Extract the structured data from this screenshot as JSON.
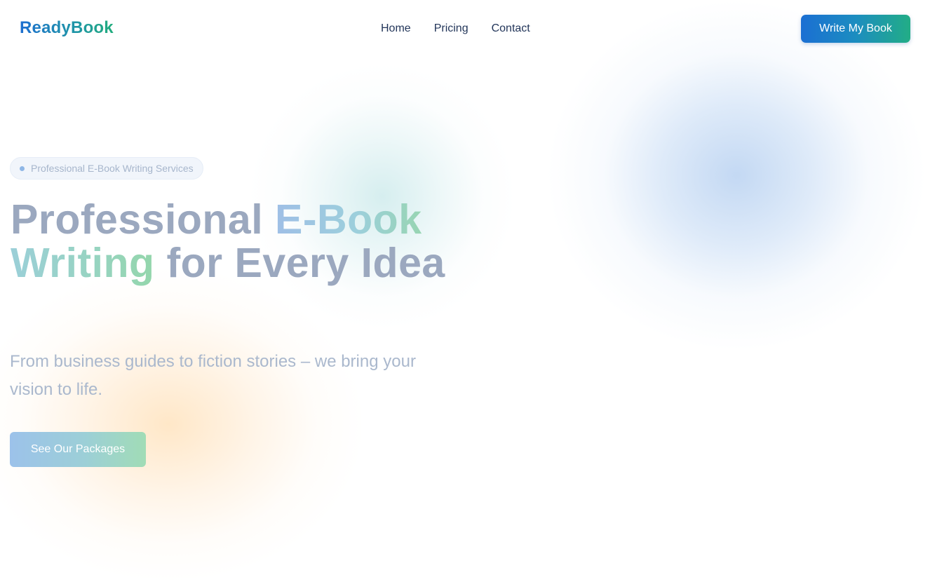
{
  "header": {
    "logo": "ReadyBook",
    "nav": [
      {
        "label": "Home"
      },
      {
        "label": "Pricing"
      },
      {
        "label": "Contact"
      }
    ],
    "cta_label": "Write My Book"
  },
  "hero": {
    "badge": "Professional E-Book Writing Services",
    "headline": {
      "part1": "Professional ",
      "highlight1": "E-Book",
      "highlight2": "Writing",
      "part2": " for Every Idea"
    },
    "subtext": "From business guides to fiction stories – we bring your vision to life.",
    "cta_label": "See Our Packages"
  },
  "colors": {
    "brand_blue": "#1b6fd3",
    "brand_green": "#22ad86",
    "heading_gray": "#9ba8bf",
    "nav_text": "#23365a"
  }
}
